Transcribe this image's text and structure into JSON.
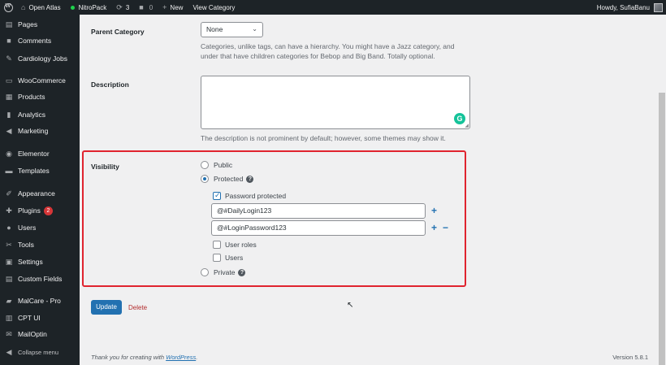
{
  "adminbar": {
    "wp_logo": "wordpress-icon",
    "site_name": "Open Atlas",
    "nitropack": "NitroPack",
    "updates_count": "3",
    "comments_count": "0",
    "new_label": "New",
    "view_category": "View Category",
    "howdy": "Howdy, SufiaBanu"
  },
  "sidebar": {
    "items": [
      {
        "label": "Pages",
        "icon": "pages-icon",
        "glyph": "▤"
      },
      {
        "label": "Comments",
        "icon": "comments-icon",
        "glyph": "■"
      },
      {
        "label": "Cardiology Jobs",
        "icon": "pin-icon",
        "glyph": "✎"
      },
      {
        "label": "WooCommerce",
        "icon": "woocommerce-icon",
        "glyph": "▭"
      },
      {
        "label": "Products",
        "icon": "products-icon",
        "glyph": "▦"
      },
      {
        "label": "Analytics",
        "icon": "analytics-icon",
        "glyph": "▮"
      },
      {
        "label": "Marketing",
        "icon": "megaphone-icon",
        "glyph": "◀"
      },
      {
        "label": "Elementor",
        "icon": "elementor-icon",
        "glyph": "◉"
      },
      {
        "label": "Templates",
        "icon": "folder-icon",
        "glyph": "▬"
      },
      {
        "label": "Appearance",
        "icon": "brush-icon",
        "glyph": "✐"
      },
      {
        "label": "Plugins",
        "icon": "plugin-icon",
        "glyph": "✚",
        "badge": "2"
      },
      {
        "label": "Users",
        "icon": "users-icon",
        "glyph": "●"
      },
      {
        "label": "Tools",
        "icon": "wrench-icon",
        "glyph": "✂"
      },
      {
        "label": "Settings",
        "icon": "settings-icon",
        "glyph": "▣"
      },
      {
        "label": "Custom Fields",
        "icon": "custom-fields-icon",
        "glyph": "▤"
      },
      {
        "label": "MalCare - Pro",
        "icon": "malcare-icon",
        "glyph": "▰"
      },
      {
        "label": "CPT UI",
        "icon": "cptui-icon",
        "glyph": "▥"
      },
      {
        "label": "MailOptin",
        "icon": "mail-icon",
        "glyph": "✉"
      },
      {
        "label": "Collapse menu",
        "icon": "collapse-icon",
        "glyph": "◀"
      }
    ]
  },
  "form": {
    "parent_label": "Parent Category",
    "parent_value": "None",
    "parent_help_1": "Categories, unlike tags, can have a hierarchy. You might have a Jazz category, and",
    "parent_help_2": "under that have children categories for Bebop and Big Band. Totally optional.",
    "description_label": "Description",
    "description_help": "The description is not prominent by default; however, some themes may show it.",
    "visibility_label": "Visibility",
    "public_label": "Public",
    "protected_label": "Protected",
    "password_protected_label": "Password protected",
    "password_1": "@#DailyLogin123",
    "password_2": "@#LoginPassword123",
    "user_roles_label": "User roles",
    "users_label": "Users",
    "private_label": "Private",
    "update_label": "Update",
    "delete_label": "Delete"
  },
  "footer": {
    "thanks_prefix": "Thank you for creating with ",
    "wordpress_link": "WordPress",
    "thanks_suffix": ".",
    "version": "Version 5.8.1"
  },
  "colors": {
    "accent": "#2271b1",
    "highlight_border": "#e0242f",
    "sidebar_bg": "#1d2327"
  }
}
